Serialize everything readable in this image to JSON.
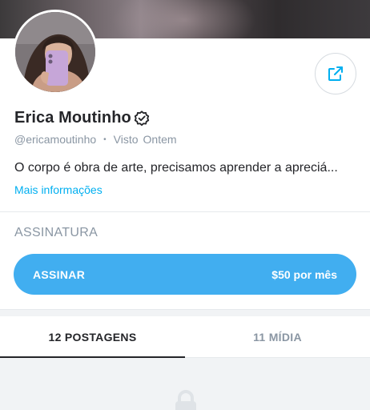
{
  "profile": {
    "name": "Erica Moutinho",
    "handle": "@ericamoutinho",
    "seen_label": "Visto",
    "seen_value": "Ontem",
    "bio": "O corpo é obra de arte, precisamos aprender a apreciá...",
    "more_label": "Mais informações"
  },
  "subscription": {
    "section_title": "ASSINATURA",
    "button_label": "ASSINAR",
    "price": "$50 por mês"
  },
  "tabs": [
    {
      "label": "12 POSTAGENS",
      "active": true
    },
    {
      "label": "11 MÍDIA",
      "active": false
    }
  ],
  "icons": {
    "share": "share-icon",
    "verified": "verified-badge-icon",
    "lock": "lock-icon"
  },
  "colors": {
    "accent": "#00aff0",
    "button": "#41aef0",
    "muted": "#8a96a3",
    "text": "#242529"
  }
}
